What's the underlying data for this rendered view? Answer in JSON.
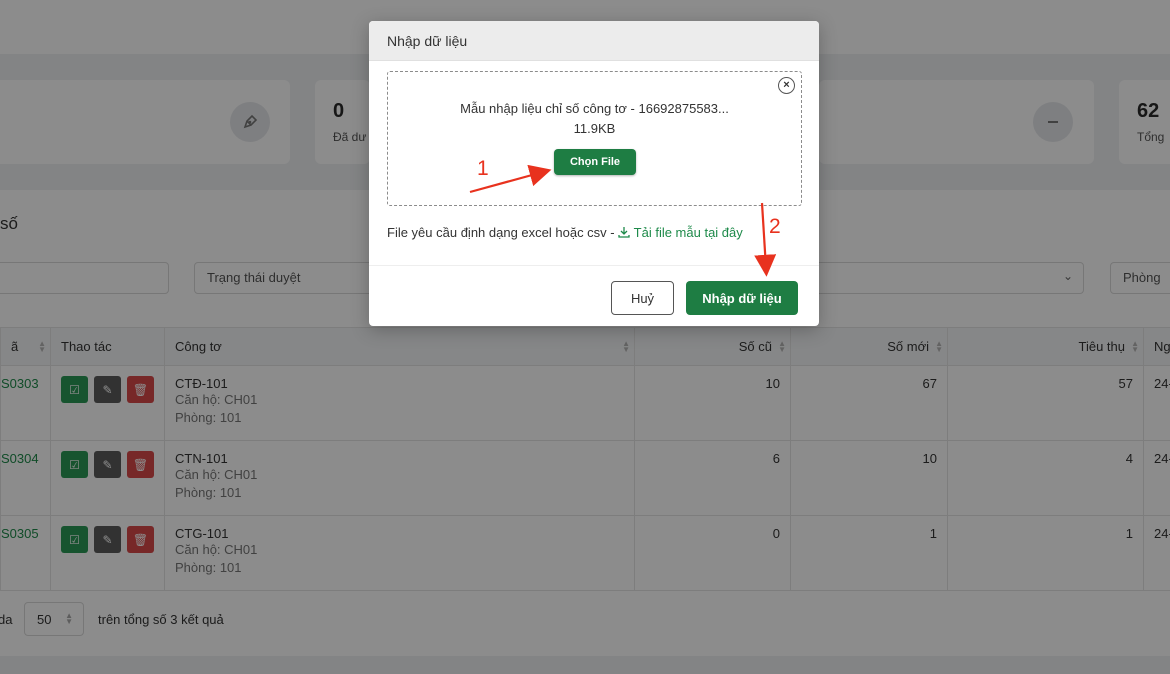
{
  "stats": [
    {
      "value": "",
      "label": ""
    },
    {
      "value": "0",
      "label": "Đã dư"
    },
    {
      "value": "",
      "label": ""
    },
    {
      "value": "62",
      "label": "Tổng"
    }
  ],
  "section_title": "số",
  "filters": {
    "search_value": "",
    "approval_status": "Trạng thái duyệt",
    "room": "Phòng"
  },
  "table": {
    "headers": [
      "ã",
      "Thao tác",
      "Công tơ",
      "Số cũ",
      "Số mới",
      "Tiêu thụ",
      "Ngà"
    ],
    "rows": [
      {
        "code": "S0303",
        "meter": "CTĐ-101",
        "apartment": "Căn hộ: CH01",
        "room": "Phòng: 101",
        "old": "10",
        "new": "67",
        "usage": "57",
        "date": "24-"
      },
      {
        "code": "S0304",
        "meter": "CTN-101",
        "apartment": "Căn hộ: CH01",
        "room": "Phòng: 101",
        "old": "6",
        "new": "10",
        "usage": "4",
        "date": "24-"
      },
      {
        "code": "S0305",
        "meter": "CTG-101",
        "apartment": "Căn hộ: CH01",
        "room": "Phòng: 101",
        "old": "0",
        "new": "1",
        "usage": "1",
        "date": "24-"
      }
    ]
  },
  "pager": {
    "prefix": "da",
    "page_size": "50",
    "summary": "trên tổng số 3 kết quả"
  },
  "modal": {
    "title": "Nhập dữ liệu",
    "file_name": "Mẫu nhập liệu chỉ số công tơ - 16692875583...",
    "file_size": "11.9KB",
    "choose_file": "Chọn File",
    "hint_text": "File yêu cầu định dạng excel hoặc csv -",
    "hint_link": "Tải file mẫu tại đây",
    "cancel": "Huỷ",
    "submit": "Nhập dữ liệu"
  },
  "annotations": {
    "step1": "1",
    "step2": "2",
    "color": "#e8321e"
  }
}
